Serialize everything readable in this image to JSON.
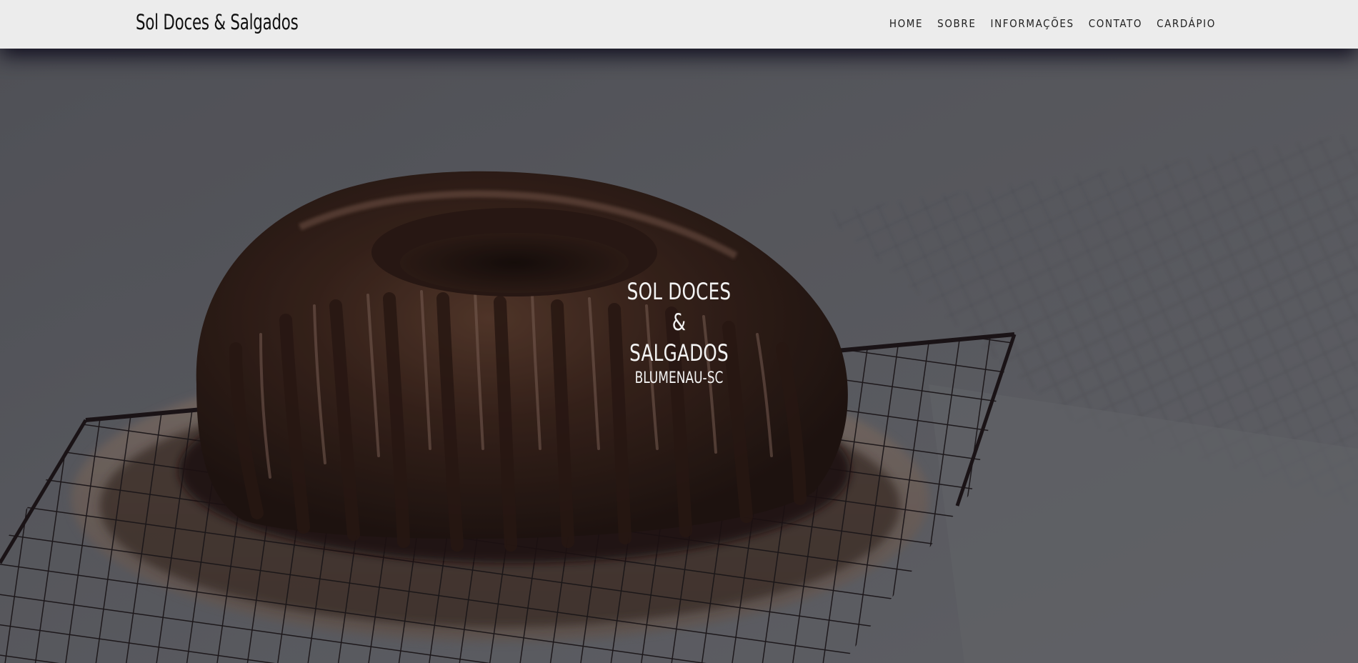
{
  "header": {
    "brand": "Sol Doces & Salgados",
    "nav": [
      {
        "label": "HOME"
      },
      {
        "label": "SOBRE"
      },
      {
        "label": "INFORMAÇÕES"
      },
      {
        "label": "CONTATO"
      },
      {
        "label": "CARDÁPIO"
      }
    ]
  },
  "hero": {
    "title_lines": [
      "SOL DOCES",
      "&",
      "SALGADOS"
    ],
    "subtitle": "BLUMENAU-SC"
  },
  "colors": {
    "navbar_bg": "#ececec",
    "hero_text": "#f3f3f3"
  }
}
